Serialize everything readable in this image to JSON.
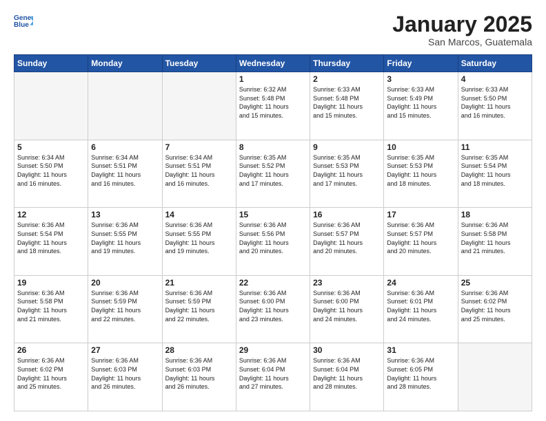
{
  "header": {
    "logo_line1": "General",
    "logo_line2": "Blue",
    "title": "January 2025",
    "subtitle": "San Marcos, Guatemala"
  },
  "weekdays": [
    "Sunday",
    "Monday",
    "Tuesday",
    "Wednesday",
    "Thursday",
    "Friday",
    "Saturday"
  ],
  "weeks": [
    [
      {
        "num": "",
        "info": ""
      },
      {
        "num": "",
        "info": ""
      },
      {
        "num": "",
        "info": ""
      },
      {
        "num": "1",
        "info": "Sunrise: 6:32 AM\nSunset: 5:48 PM\nDaylight: 11 hours\nand 15 minutes."
      },
      {
        "num": "2",
        "info": "Sunrise: 6:33 AM\nSunset: 5:48 PM\nDaylight: 11 hours\nand 15 minutes."
      },
      {
        "num": "3",
        "info": "Sunrise: 6:33 AM\nSunset: 5:49 PM\nDaylight: 11 hours\nand 15 minutes."
      },
      {
        "num": "4",
        "info": "Sunrise: 6:33 AM\nSunset: 5:50 PM\nDaylight: 11 hours\nand 16 minutes."
      }
    ],
    [
      {
        "num": "5",
        "info": "Sunrise: 6:34 AM\nSunset: 5:50 PM\nDaylight: 11 hours\nand 16 minutes."
      },
      {
        "num": "6",
        "info": "Sunrise: 6:34 AM\nSunset: 5:51 PM\nDaylight: 11 hours\nand 16 minutes."
      },
      {
        "num": "7",
        "info": "Sunrise: 6:34 AM\nSunset: 5:51 PM\nDaylight: 11 hours\nand 16 minutes."
      },
      {
        "num": "8",
        "info": "Sunrise: 6:35 AM\nSunset: 5:52 PM\nDaylight: 11 hours\nand 17 minutes."
      },
      {
        "num": "9",
        "info": "Sunrise: 6:35 AM\nSunset: 5:53 PM\nDaylight: 11 hours\nand 17 minutes."
      },
      {
        "num": "10",
        "info": "Sunrise: 6:35 AM\nSunset: 5:53 PM\nDaylight: 11 hours\nand 18 minutes."
      },
      {
        "num": "11",
        "info": "Sunrise: 6:35 AM\nSunset: 5:54 PM\nDaylight: 11 hours\nand 18 minutes."
      }
    ],
    [
      {
        "num": "12",
        "info": "Sunrise: 6:36 AM\nSunset: 5:54 PM\nDaylight: 11 hours\nand 18 minutes."
      },
      {
        "num": "13",
        "info": "Sunrise: 6:36 AM\nSunset: 5:55 PM\nDaylight: 11 hours\nand 19 minutes."
      },
      {
        "num": "14",
        "info": "Sunrise: 6:36 AM\nSunset: 5:55 PM\nDaylight: 11 hours\nand 19 minutes."
      },
      {
        "num": "15",
        "info": "Sunrise: 6:36 AM\nSunset: 5:56 PM\nDaylight: 11 hours\nand 20 minutes."
      },
      {
        "num": "16",
        "info": "Sunrise: 6:36 AM\nSunset: 5:57 PM\nDaylight: 11 hours\nand 20 minutes."
      },
      {
        "num": "17",
        "info": "Sunrise: 6:36 AM\nSunset: 5:57 PM\nDaylight: 11 hours\nand 20 minutes."
      },
      {
        "num": "18",
        "info": "Sunrise: 6:36 AM\nSunset: 5:58 PM\nDaylight: 11 hours\nand 21 minutes."
      }
    ],
    [
      {
        "num": "19",
        "info": "Sunrise: 6:36 AM\nSunset: 5:58 PM\nDaylight: 11 hours\nand 21 minutes."
      },
      {
        "num": "20",
        "info": "Sunrise: 6:36 AM\nSunset: 5:59 PM\nDaylight: 11 hours\nand 22 minutes."
      },
      {
        "num": "21",
        "info": "Sunrise: 6:36 AM\nSunset: 5:59 PM\nDaylight: 11 hours\nand 22 minutes."
      },
      {
        "num": "22",
        "info": "Sunrise: 6:36 AM\nSunset: 6:00 PM\nDaylight: 11 hours\nand 23 minutes."
      },
      {
        "num": "23",
        "info": "Sunrise: 6:36 AM\nSunset: 6:00 PM\nDaylight: 11 hours\nand 24 minutes."
      },
      {
        "num": "24",
        "info": "Sunrise: 6:36 AM\nSunset: 6:01 PM\nDaylight: 11 hours\nand 24 minutes."
      },
      {
        "num": "25",
        "info": "Sunrise: 6:36 AM\nSunset: 6:02 PM\nDaylight: 11 hours\nand 25 minutes."
      }
    ],
    [
      {
        "num": "26",
        "info": "Sunrise: 6:36 AM\nSunset: 6:02 PM\nDaylight: 11 hours\nand 25 minutes."
      },
      {
        "num": "27",
        "info": "Sunrise: 6:36 AM\nSunset: 6:03 PM\nDaylight: 11 hours\nand 26 minutes."
      },
      {
        "num": "28",
        "info": "Sunrise: 6:36 AM\nSunset: 6:03 PM\nDaylight: 11 hours\nand 26 minutes."
      },
      {
        "num": "29",
        "info": "Sunrise: 6:36 AM\nSunset: 6:04 PM\nDaylight: 11 hours\nand 27 minutes."
      },
      {
        "num": "30",
        "info": "Sunrise: 6:36 AM\nSunset: 6:04 PM\nDaylight: 11 hours\nand 28 minutes."
      },
      {
        "num": "31",
        "info": "Sunrise: 6:36 AM\nSunset: 6:05 PM\nDaylight: 11 hours\nand 28 minutes."
      },
      {
        "num": "",
        "info": ""
      }
    ]
  ]
}
